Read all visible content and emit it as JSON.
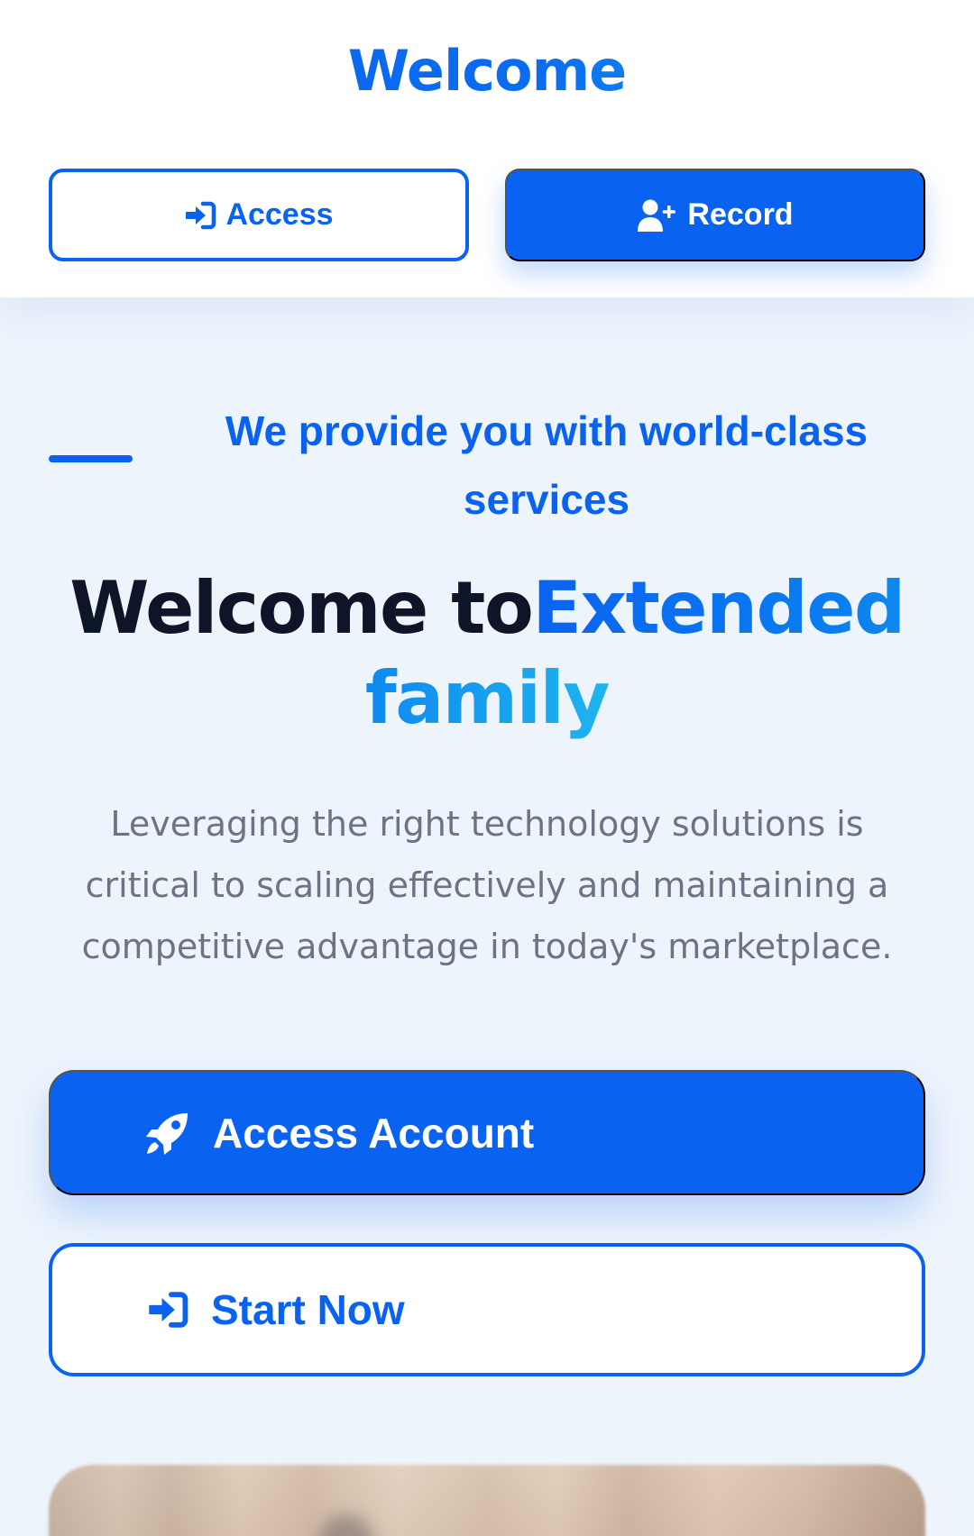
{
  "header": {
    "brand": "Welcome",
    "access_label": "Access",
    "record_label": "Record"
  },
  "hero": {
    "tagline": "We provide you with world-class services",
    "title_prefix": "Welcome to",
    "title_highlight": "Extended family",
    "description": "Leveraging the right technology solutions is critical to scaling effectively and maintaining a competitive advantage in today's marketplace."
  },
  "cta": {
    "primary_label": "Access Account",
    "secondary_label": "Start Now"
  },
  "icons": {
    "access": "sign-in-icon",
    "record": "user-plus-icon",
    "primary": "rocket-icon",
    "secondary": "sign-in-icon"
  },
  "colors": {
    "primary": "#0a63f0",
    "gradient_end": "#1fb4ef",
    "heading": "#0d1628",
    "body_text": "#6b7484",
    "background": "#eef4fc"
  }
}
